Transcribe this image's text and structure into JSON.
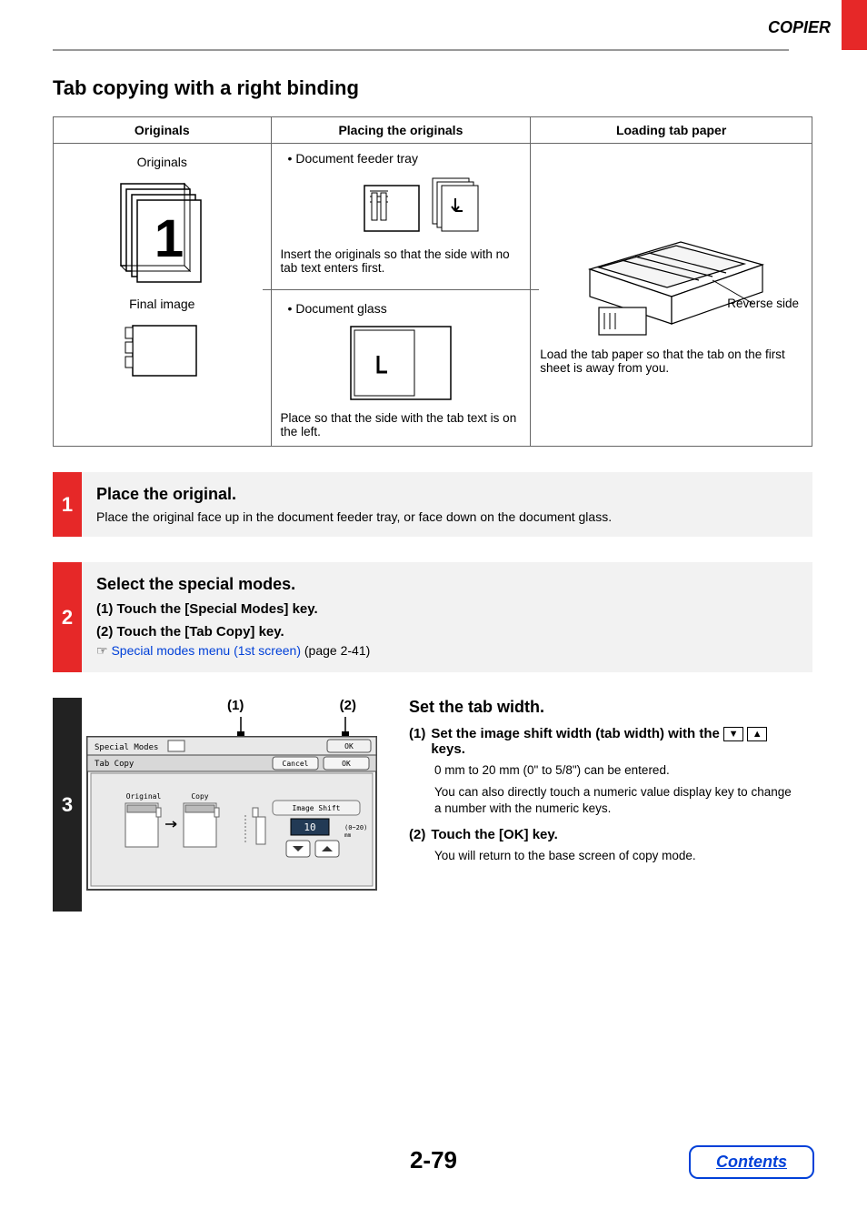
{
  "header": {
    "section_name": "COPIER"
  },
  "title": "Tab copying with a right binding",
  "table": {
    "headers": [
      "Originals",
      "Placing the originals",
      "Loading tab paper"
    ],
    "col1": {
      "originals_label": "Originals",
      "big_digit": "1",
      "final_image_label": "Final image"
    },
    "col2": {
      "bullet1": "• Document feeder tray",
      "caption1": "Insert the originals so that the side with no tab text enters first.",
      "bullet2": "• Document glass",
      "caption2": "Place so that the side with the tab text is on the left."
    },
    "col3": {
      "reverse_side": "Reverse side",
      "caption": "Load the tab paper so that the tab on the first sheet is away from you."
    }
  },
  "steps": {
    "s1": {
      "num": "1",
      "title": "Place the original.",
      "text": "Place the original face up in the document feeder tray, or face down on the document glass."
    },
    "s2": {
      "num": "2",
      "title": "Select the special modes.",
      "sub1": "(1)   Touch the [Special Modes] key.",
      "sub2": "(2)   Touch the [Tab Copy] key.",
      "hand": "☞",
      "link_text": "Special modes menu (1st screen)",
      "link_suffix": " (page 2-41)"
    },
    "s3": {
      "num": "3",
      "callout1": "(1)",
      "callout2": "(2)",
      "panel": {
        "special_modes": "Special Modes",
        "tab_copy": "Tab Copy",
        "top_ok": "OK",
        "cancel": "Cancel",
        "ok": "OK",
        "original": "Original",
        "copy": "Copy",
        "image_shift": "Image Shift",
        "value": "10",
        "range": "(0~20)",
        "mm": "mm"
      },
      "right_title": "Set the tab width.",
      "sub1_num": "(1)",
      "sub1_text_a": "Set the image shift width (tab width) with the ",
      "sub1_text_b": " keys.",
      "sub1_desc1": "0 mm to 20 mm (0\" to 5/8\") can be entered.",
      "sub1_desc2": "You can also directly touch a numeric value display key to change a number with the numeric keys.",
      "sub2_num": "(2)",
      "sub2_text": "Touch the [OK] key.",
      "sub2_desc": "You will return to the base screen of copy mode."
    }
  },
  "page_number": "2-79",
  "contents_button": "Contents"
}
